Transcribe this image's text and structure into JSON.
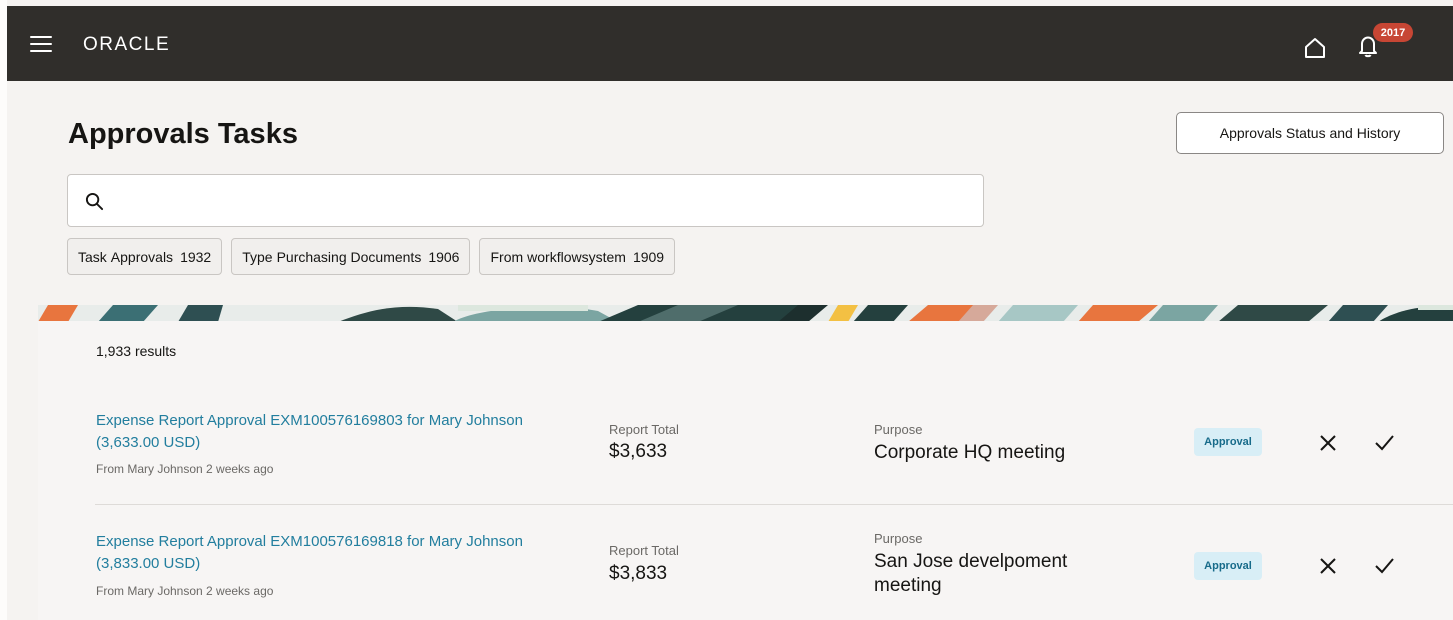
{
  "header": {
    "logo_text": "ORACLE",
    "notification_count": "2017"
  },
  "page": {
    "title": "Approvals Tasks",
    "history_button_label": "Approvals Status and History"
  },
  "search": {
    "value": "",
    "placeholder": ""
  },
  "filters": [
    {
      "name": "Task",
      "value": "Approvals",
      "count": "1932"
    },
    {
      "name": "Type",
      "value": "Purchasing Documents",
      "count": "1906"
    },
    {
      "name": "From",
      "value": "workflowsystem",
      "count": "1909"
    }
  ],
  "results": {
    "count_number": "1,933",
    "count_suffix": "results",
    "items": [
      {
        "title_line1": "Expense Report Approval EXM100576169803 for Mary Johnson",
        "title_line2": "(3,633.00 USD)",
        "from": "From Mary Johnson 2 weeks ago",
        "total_label": "Report Total",
        "total_value": "$3,633",
        "purpose_label": "Purpose",
        "purpose_value": "Corporate HQ meeting",
        "badge": "Approval"
      },
      {
        "title_line1": "Expense Report Approval EXM100576169818 for Mary Johnson",
        "title_line2": "(3,833.00 USD)",
        "from": "From Mary Johnson 2 weeks ago",
        "total_label": "Report Total",
        "total_value": "$3,833",
        "purpose_label": "Purpose",
        "purpose_value": "San Jose develpoment meeting",
        "badge": "Approval"
      }
    ]
  },
  "icons": {
    "menu": "hamburger-menu-icon",
    "home": "home-icon",
    "notifications": "bell-icon",
    "search": "search-icon",
    "reject": "close-icon",
    "approve": "checkmark-icon"
  },
  "colors": {
    "header_bg": "#302e2b",
    "link": "#227e9e",
    "badge_bg": "#c74634",
    "approval_bg": "#d8eef6",
    "approval_text": "#176b8a"
  }
}
